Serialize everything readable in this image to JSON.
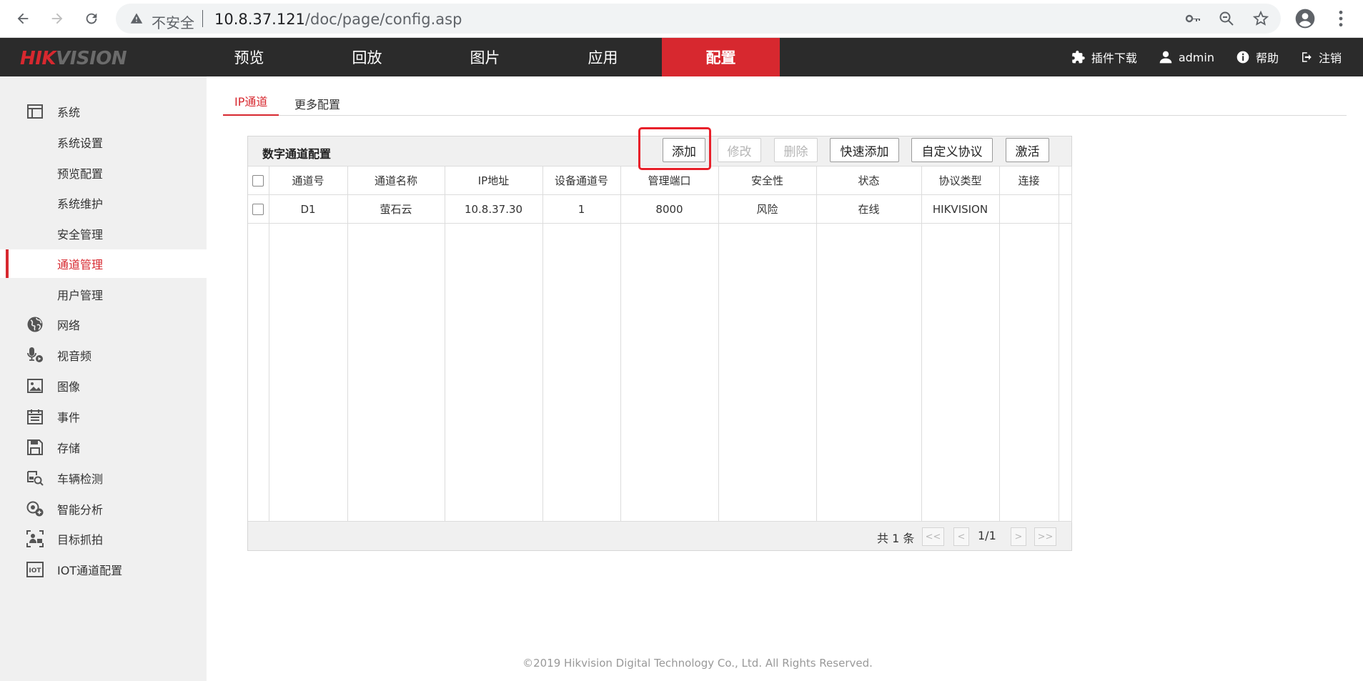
{
  "browser": {
    "insecure_label": "不安全",
    "url_host": "10.8.37.121",
    "url_path": "/doc/page/config.asp"
  },
  "brand": {
    "part1": "HIK",
    "part2": "VISION"
  },
  "top_nav": [
    "预览",
    "回放",
    "图片",
    "应用",
    "配置"
  ],
  "top_nav_active": "配置",
  "toolbar": {
    "plugin": "插件下载",
    "user": "admin",
    "help": "帮助",
    "logout": "注销"
  },
  "sidebar": {
    "system": "系统",
    "system_sub": [
      "系统设置",
      "预览配置",
      "系统维护",
      "安全管理",
      "通道管理",
      "用户管理"
    ],
    "active": "通道管理",
    "groups": [
      "网络",
      "视音频",
      "图像",
      "事件",
      "存储",
      "车辆检测",
      "智能分析",
      "目标抓拍",
      "IOT通道配置"
    ]
  },
  "tabs": {
    "ip_channel": "IP通道",
    "more_config": "更多配置"
  },
  "panel": {
    "title": "数字通道配置",
    "buttons": {
      "add": "添加",
      "modify": "修改",
      "delete": "删除",
      "quick_add": "快速添加",
      "custom_protocol": "自定义协议",
      "activate": "激活"
    },
    "columns": [
      "通道号",
      "通道名称",
      "IP地址",
      "设备通道号",
      "管理端口",
      "安全性",
      "状态",
      "协议类型",
      "连接"
    ],
    "rows": [
      {
        "channel": "D1",
        "name": "萤石云",
        "ip": "10.8.37.30",
        "device_channel": "1",
        "port": "8000",
        "security": "风险",
        "status": "在线",
        "protocol": "HIKVISION",
        "connection": ""
      }
    ],
    "footer": {
      "count": "共 1 条",
      "first": "<<",
      "prev": "<",
      "page": "1/1",
      "next": ">",
      "last": ">>"
    }
  },
  "copyright": "©2019 Hikvision Digital Technology Co., Ltd. All Rights Reserved."
}
